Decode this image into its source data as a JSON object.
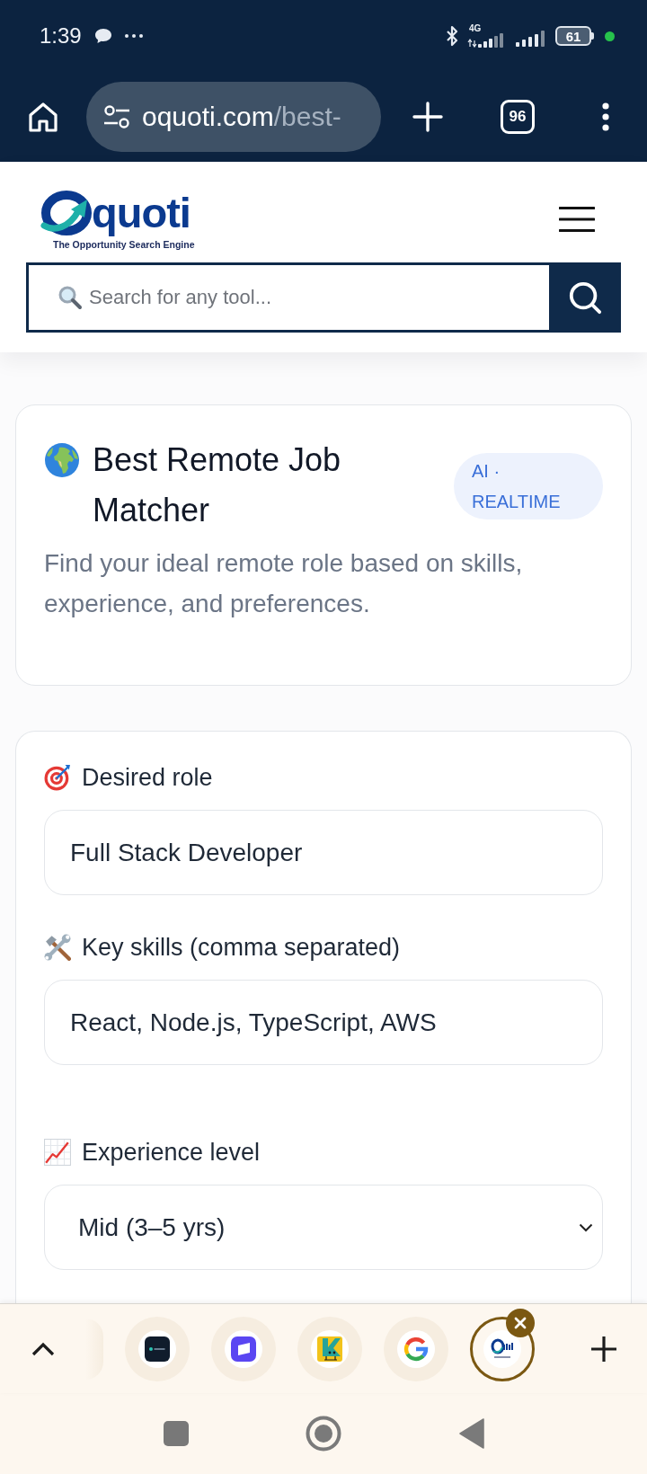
{
  "status_bar": {
    "time": "1:39",
    "network": "4G",
    "battery": "61"
  },
  "browser_toolbar": {
    "url_domain": "oquoti.com",
    "url_path": "/best-",
    "tab_count": "96"
  },
  "site_header": {
    "logo_wordmark": "quoti",
    "logo_tagline": "The Opportunity Search Engine",
    "search": {
      "placeholder": "Search for any tool..."
    }
  },
  "tool_card": {
    "title": "Best Remote Job Matcher",
    "badge": "AI · REALTIME",
    "description": "Find your ideal remote role based on skills, experience, and preferences."
  },
  "form": {
    "fields": [
      {
        "kind": "text",
        "label": "Desired role",
        "value": "Full Stack Developer"
      },
      {
        "kind": "text",
        "label": "Key skills (comma separated)",
        "value": "React, Node.js, TypeScript, AWS"
      },
      {
        "kind": "select",
        "label": "Experience level",
        "value": "Mid (3–5 yrs)"
      }
    ]
  },
  "tab_strip": {
    "tabs": [
      {
        "selected": false
      },
      {
        "selected": false
      },
      {
        "selected": false
      },
      {
        "selected": false
      },
      {
        "selected": true
      }
    ]
  }
}
